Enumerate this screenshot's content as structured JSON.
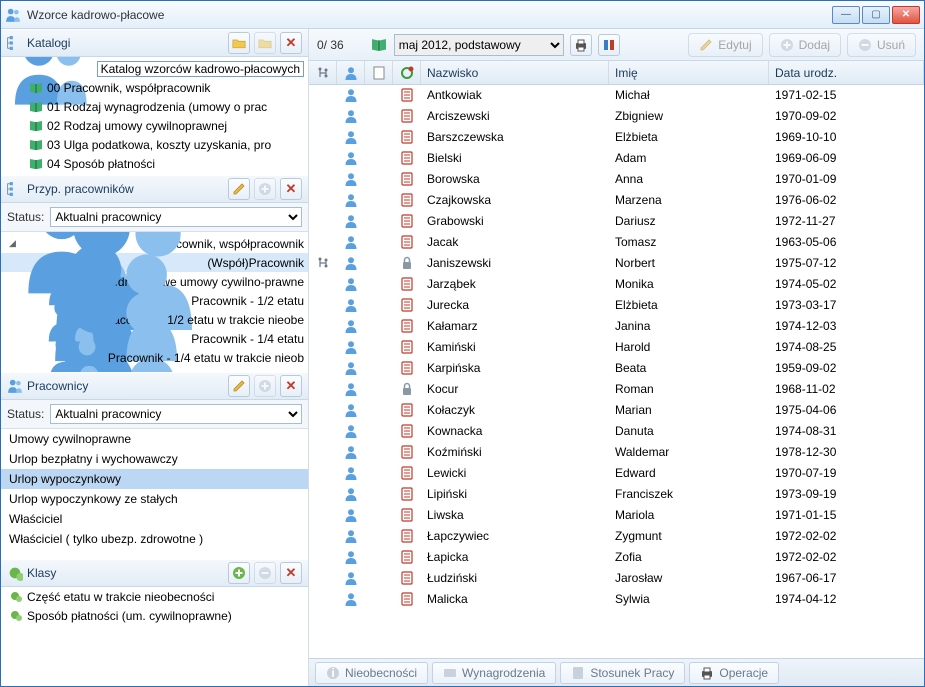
{
  "window": {
    "title": "Wzorce kadrowo-płacowe"
  },
  "left": {
    "katalogi": {
      "header": "Katalogi",
      "root": "Katalog wzorców kadrowo-płacowych",
      "items": [
        "00 Pracownik, współpracownik",
        "01 Rodzaj wynagrodzenia (umowy o prac",
        "02 Rodzaj umowy cywilnoprawnej",
        "03 Ulga podatkowa, koszty uzyskania, pro",
        "04 Sposób płatności"
      ]
    },
    "przyp": {
      "header": "Przyp. pracowników",
      "status_label": "Status:",
      "status_value": "Aktualni pracownicy",
      "root": "00 Pracownik, współpracownik",
      "items": [
        "(Współ)Pracownik",
        "Jednorazowe umowy cywilno-prawne",
        "Pracownik - 1/2 etatu",
        "Pracownik - 1/2 etatu w trakcie nieobe",
        "Pracownik - 1/4 etatu",
        "Pracownik - 1/4 etatu w trakcie nieob"
      ]
    },
    "pracownicy": {
      "header": "Pracownicy",
      "status_label": "Status:",
      "status_value": "Aktualni pracownicy",
      "items": [
        "Umowy cywilnoprawne",
        "Urlop bezpłatny i wychowawczy",
        "Urlop wypoczynkowy",
        "Urlop wypoczynkowy ze stałych",
        "Właściciel",
        "Właściciel ( tylko ubezp. zdrowotne )"
      ],
      "selected_index": 2
    },
    "klasy": {
      "header": "Klasy",
      "items": [
        "Część etatu w trakcie nieobecności",
        "Sposób płatności (um. cywilnoprawne)"
      ]
    }
  },
  "toolbar": {
    "counter": "0/ 36",
    "period": "maj 2012, podstawowy",
    "edit": "Edytuj",
    "add": "Dodaj",
    "del": "Usuń"
  },
  "grid": {
    "headers": {
      "name": "Nazwisko",
      "first": "Imię",
      "dob": "Data urodz."
    },
    "rows": [
      {
        "n": "Antkowiak",
        "f": "Michał",
        "d": "1971-02-15",
        "lock": false
      },
      {
        "n": "Arciszewski",
        "f": "Zbigniew",
        "d": "1970-09-02",
        "lock": false
      },
      {
        "n": "Barszczewska",
        "f": "Elżbieta",
        "d": "1969-10-10",
        "lock": false
      },
      {
        "n": "Bielski",
        "f": "Adam",
        "d": "1969-06-09",
        "lock": false
      },
      {
        "n": "Borowska",
        "f": "Anna",
        "d": "1970-01-09",
        "lock": false
      },
      {
        "n": "Czajkowska",
        "f": "Marzena",
        "d": "1976-06-02",
        "lock": false
      },
      {
        "n": "Grabowski",
        "f": "Dariusz",
        "d": "1972-11-27",
        "lock": false
      },
      {
        "n": "Jacak",
        "f": "Tomasz",
        "d": "1963-05-06",
        "lock": false
      },
      {
        "n": "Janiszewski",
        "f": "Norbert",
        "d": "1975-07-12",
        "lock": true,
        "alt": true
      },
      {
        "n": "Jarząbek",
        "f": "Monika",
        "d": "1974-05-02",
        "lock": false
      },
      {
        "n": "Jurecka",
        "f": "Elżbieta",
        "d": "1973-03-17",
        "lock": false
      },
      {
        "n": "Kałamarz",
        "f": "Janina",
        "d": "1974-12-03",
        "lock": false
      },
      {
        "n": "Kamiński",
        "f": "Harold",
        "d": "1974-08-25",
        "lock": false
      },
      {
        "n": "Karpińska",
        "f": "Beata",
        "d": "1959-09-02",
        "lock": false
      },
      {
        "n": "Kocur",
        "f": "Roman",
        "d": "1968-11-02",
        "lock": true
      },
      {
        "n": "Kołaczyk",
        "f": "Marian",
        "d": "1975-04-06",
        "lock": false
      },
      {
        "n": "Kownacka",
        "f": "Danuta",
        "d": "1974-08-31",
        "lock": false
      },
      {
        "n": "Koźmiński",
        "f": "Waldemar",
        "d": "1978-12-30",
        "lock": false
      },
      {
        "n": "Lewicki",
        "f": "Edward",
        "d": "1970-07-19",
        "lock": false
      },
      {
        "n": "Lipiński",
        "f": "Franciszek",
        "d": "1973-09-19",
        "lock": false
      },
      {
        "n": "Liwska",
        "f": "Mariola",
        "d": "1971-01-15",
        "lock": false
      },
      {
        "n": "Łapczywiec",
        "f": "Zygmunt",
        "d": "1972-02-02",
        "lock": false
      },
      {
        "n": "Łapicka",
        "f": "Zofia",
        "d": "1972-02-02",
        "lock": false
      },
      {
        "n": "Łudziński",
        "f": "Jarosław",
        "d": "1967-06-17",
        "lock": false
      },
      {
        "n": "Malicka",
        "f": "Sylwia",
        "d": "1974-04-12",
        "lock": false
      }
    ]
  },
  "tabs": {
    "t1": "Nieobecności",
    "t2": "Wynagrodzenia",
    "t3": "Stosunek Pracy",
    "t4": "Operacje"
  }
}
